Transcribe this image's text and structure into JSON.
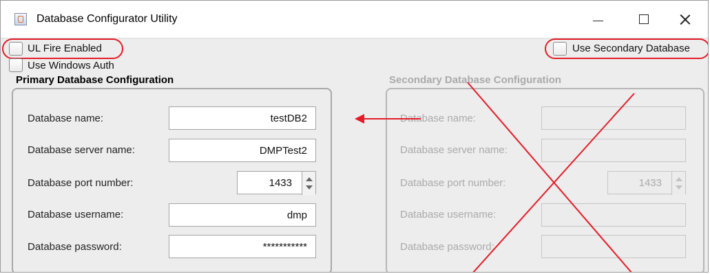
{
  "window": {
    "title": "Database Configurator Utility",
    "app_icon": "java-cup-icon",
    "buttons": [
      "minimize-icon",
      "maximize-icon",
      "close-icon"
    ]
  },
  "options": {
    "ul_fire_label": "UL Fire Enabled",
    "windows_auth_label": "Use Windows Auth",
    "secondary_database_label": "Use Secondary Database"
  },
  "primary": {
    "title": "Primary Database Configuration",
    "fields": [
      {
        "label": "Database name:",
        "value": "testDB2"
      },
      {
        "label": "Database server name:",
        "value": "DMPTest2"
      },
      {
        "label": "Database port number:",
        "value": "1433"
      },
      {
        "label": "Database username:",
        "value": "dmp"
      },
      {
        "label": "Database password:",
        "value": "***********"
      }
    ]
  },
  "secondary": {
    "title": "Secondary Database Configuration",
    "fields": [
      {
        "label": "Database name:",
        "value": ""
      },
      {
        "label": "Database server name:",
        "value": ""
      },
      {
        "label": "Database port number:",
        "value": "1433"
      },
      {
        "label": "Database username:",
        "value": ""
      },
      {
        "label": "Database password:",
        "value": ""
      }
    ]
  },
  "annotations": {
    "accent_color": "#e31c27"
  }
}
